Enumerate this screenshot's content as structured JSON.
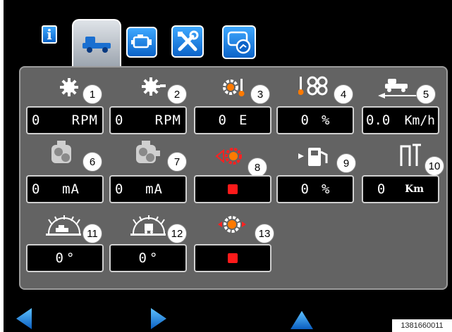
{
  "tabs": [
    {
      "icon": "info-icon",
      "label": "i",
      "active": false
    },
    {
      "icon": "vehicle-icon",
      "active": true
    },
    {
      "icon": "engine-icon",
      "active": false
    },
    {
      "icon": "tools-icon",
      "active": false
    },
    {
      "icon": "gauge-settings-icon",
      "active": false
    }
  ],
  "items": [
    {
      "number": "1",
      "icon": "rpm-gear-icon",
      "value": "0",
      "unit": "RPM"
    },
    {
      "number": "2",
      "icon": "rpm-gear-alt-icon",
      "value": "0",
      "unit": "RPM"
    },
    {
      "number": "3",
      "icon": "gear-temperature-icon",
      "value": "0",
      "unit": "E"
    },
    {
      "number": "4",
      "icon": "fan-temperature-icon",
      "value": "0",
      "unit": "%"
    },
    {
      "number": "5",
      "icon": "vehicle-speed-icon",
      "value": "0.0",
      "unit": "Km/h"
    },
    {
      "number": "6",
      "icon": "pump-icon",
      "value": "0",
      "unit": "mA"
    },
    {
      "number": "7",
      "icon": "pump-alt-icon",
      "value": "0",
      "unit": "mA"
    },
    {
      "number": "8",
      "icon": "gear-warning-icon",
      "status": "off"
    },
    {
      "number": "9",
      "icon": "fuel-level-icon",
      "value": "0",
      "unit": "%"
    },
    {
      "number": "10",
      "icon": "lift-height-icon",
      "value": "0",
      "unit": "Km"
    },
    {
      "number": "11",
      "icon": "inclination-icon",
      "value": "0",
      "unit": "°"
    },
    {
      "number": "12",
      "icon": "inclination-alt-icon",
      "value": "0",
      "unit": "°"
    },
    {
      "number": "13",
      "icon": "gear-indicator-icon",
      "status": "off"
    }
  ],
  "navigation": {
    "left": "left-arrow-icon",
    "right": "right-arrow-icon",
    "up": "up-arrow-icon"
  },
  "image_code": "1381660011",
  "colors": {
    "accent": "#1a8fff",
    "panel": "#636363",
    "status_off": "#ff1a1a",
    "icon_orange": "#ff7a00"
  }
}
